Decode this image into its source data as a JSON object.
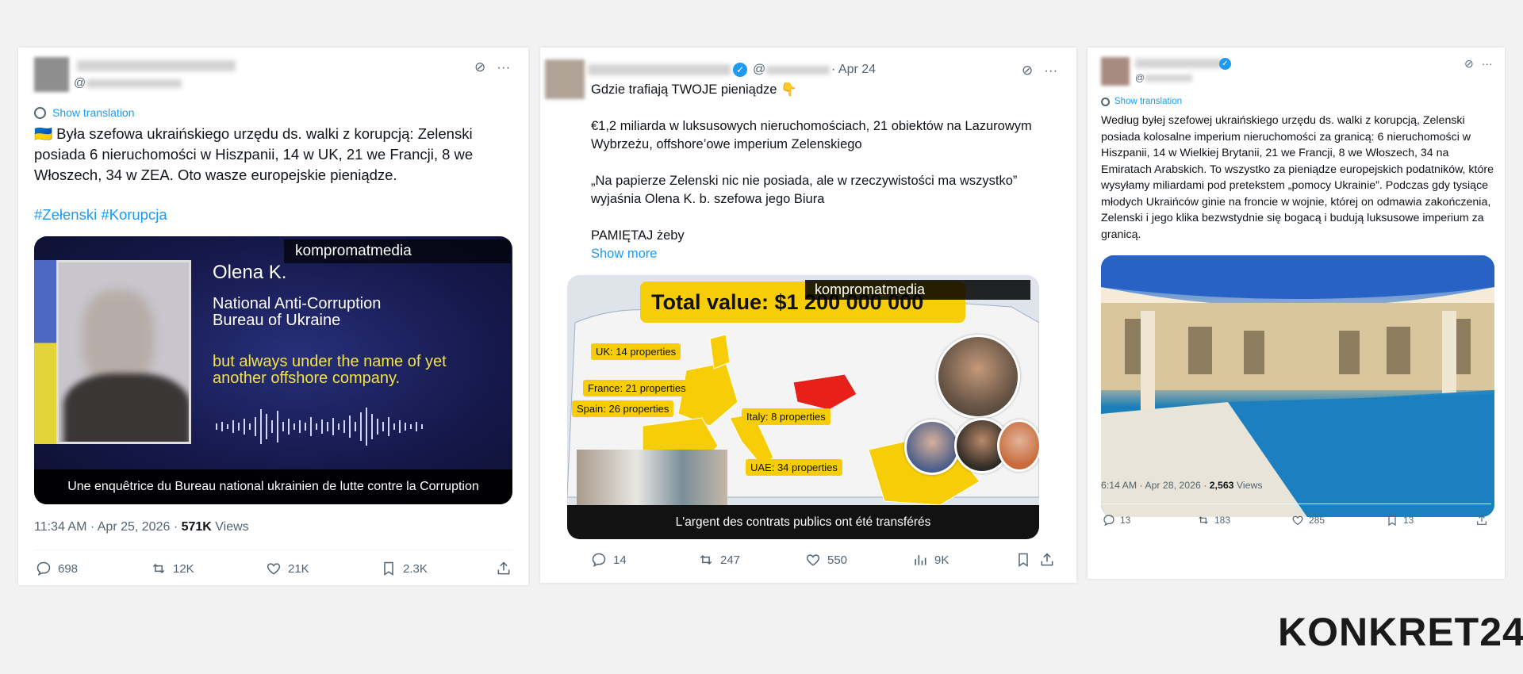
{
  "tweet1": {
    "handle_prefix": "@",
    "show_translation": "Show translation",
    "text": "🇺🇦 Była szefowa ukraińskiego urzędu ds. walki z korupcją: Zelenski posiada 6 nieruchomości w Hiszpanii, 14 w UK, 21 we Francji, 8 we Włoszech, 34 w ZEA. Oto wasze europejskie pieniądze.",
    "hashtags": "#Zełenski #Korupcja",
    "media": {
      "watermark": "kompromatmedia",
      "name": "Olena K.",
      "org_line1": "National Anti-Corruption",
      "org_line2": "Bureau of Ukraine",
      "subtitle_line1": "but always under the name of yet",
      "subtitle_line2": "another offshore company.",
      "caption": "Une enquêtrice du Bureau national ukrainien de lutte contre la Corruption"
    },
    "timestamp": "11:34 AM · Apr 25, 2026 · ",
    "views_count": "571K",
    "views_label": " Views",
    "actions": {
      "replies": "698",
      "reposts": "12K",
      "likes": "21K",
      "bookmarks": "2.3K"
    }
  },
  "tweet2": {
    "handle_prefix": "@",
    "date": "· Apr 24",
    "line1": "Gdzie trafiają TWOJE pieniądze 👇",
    "para1": "€1,2 miliarda w luksusowych nieruchomościach, 21 obiektów na Lazurowym Wybrzeżu, offshore’owe imperium Zelenskiego",
    "para2": "„Na papierze Zelenski nic nie posiada, ale w rzeczywistości ma wszystko” wyjaśnia Olena K. b. szefowa jego Biura",
    "para3": "PAMIĘTAJ żeby",
    "show_more": "Show more",
    "media": {
      "banner": "Total value: $1 200 000 000",
      "watermark": "kompromatmedia",
      "labels": [
        "UK: 14 properties",
        "France: 21 properties",
        "Spain: 26 properties",
        "Italy: 8 properties",
        "UAE: 34 properties"
      ],
      "caption": "L'argent des contrats publics ont été transférés"
    },
    "actions": {
      "replies": "14",
      "reposts": "247",
      "likes": "550",
      "views": "9K"
    }
  },
  "tweet3": {
    "handle_prefix": "@",
    "show_translation": "Show translation",
    "text": "Według byłej szefowej ukraińskiego urzędu ds. walki z korupcją, Zelenski posiada kolosalne imperium nieruchomości za granicą: 6 nieruchomości w Hiszpanii, 14 w Wielkiej Brytanii, 21 we Francji, 8 we Włoszech, 34 na Emiratach Arabskich.  To wszystko za pieniądze europejskich podatników, które wysyłamy miliardami pod pretekstem „pomocy Ukrainie”. Podczas gdy tysiące młodych Ukraińców ginie na froncie w wojnie, której on odmawia zakończenia, Zelenski i jego klika bezwstydnie się bogacą i budują luksusowe imperium za granicą.",
    "timestamp": "6:14 AM · Apr 28, 2026 · ",
    "views_count": "2,563",
    "views_label": " Views",
    "actions": {
      "replies": "13",
      "reposts": "183",
      "likes": "285",
      "bookmarks": "13"
    }
  },
  "logo": "KONKRET24",
  "colors": {
    "accent": "#1d9bf0",
    "muted": "#536471",
    "yellow": "#f6cd06"
  }
}
